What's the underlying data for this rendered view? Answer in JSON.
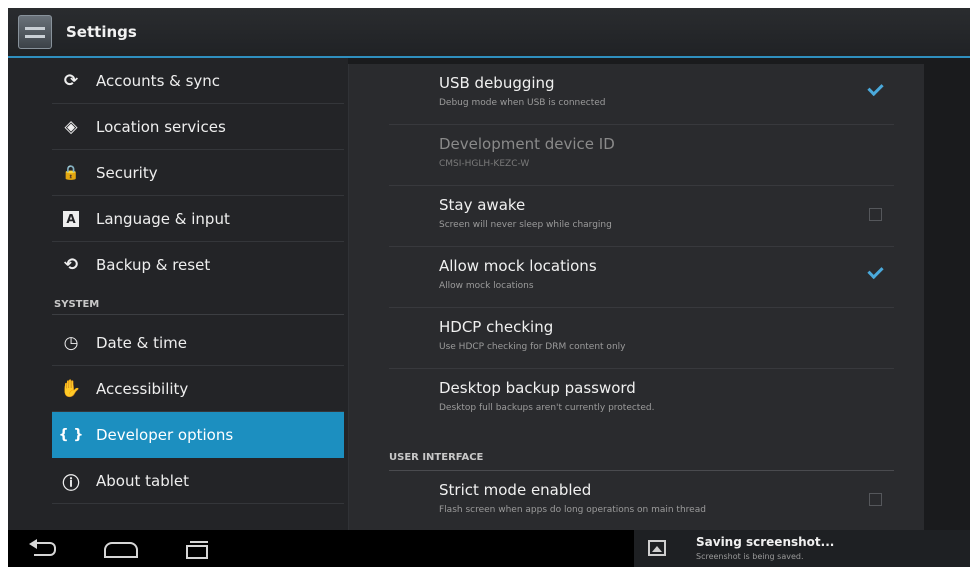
{
  "app": {
    "title": "Settings"
  },
  "sidebar": {
    "items": [
      {
        "label": "Accounts & sync",
        "icon": "sync-icon",
        "glyph": "⟳"
      },
      {
        "label": "Location services",
        "icon": "location-icon",
        "glyph": "◈"
      },
      {
        "label": "Security",
        "icon": "lock-icon",
        "glyph": "🔒"
      },
      {
        "label": "Language & input",
        "icon": "keyboard-icon",
        "glyph": "A"
      },
      {
        "label": "Backup & reset",
        "icon": "backup-icon",
        "glyph": "⟲"
      }
    ],
    "section_system": "SYSTEM",
    "system_items": [
      {
        "label": "Date & time",
        "icon": "clock-icon",
        "glyph": "◷"
      },
      {
        "label": "Accessibility",
        "icon": "hand-icon",
        "glyph": "✋"
      },
      {
        "label": "Developer options",
        "icon": "braces-icon",
        "glyph": "{ }",
        "selected": true
      },
      {
        "label": "About tablet",
        "icon": "info-icon",
        "glyph": "ⓘ"
      }
    ]
  },
  "developer_options": {
    "prefs": [
      {
        "title": "USB debugging",
        "summary": "Debug mode when USB is connected",
        "checked": true
      },
      {
        "title": "Development device ID",
        "summary": "CMSI-HGLH-KEZC-W",
        "disabled": true
      },
      {
        "title": "Stay awake",
        "summary": "Screen will never sleep while charging",
        "checked": false
      },
      {
        "title": "Allow mock locations",
        "summary": "Allow mock locations",
        "checked": true
      },
      {
        "title": "HDCP checking",
        "summary": "Use HDCP checking for DRM content only"
      },
      {
        "title": "Desktop backup password",
        "summary": "Desktop full backups aren't currently protected."
      }
    ],
    "section_ui": "USER INTERFACE",
    "ui_prefs": [
      {
        "title": "Strict mode enabled",
        "summary": "Flash screen when apps do long operations on main thread",
        "checked": false
      }
    ]
  },
  "notification": {
    "title": "Saving screenshot...",
    "text": "Screenshot is being saved."
  },
  "colors": {
    "accent": "#1c8fc0",
    "check": "#4aa9db",
    "background": "#1a1b1d"
  }
}
